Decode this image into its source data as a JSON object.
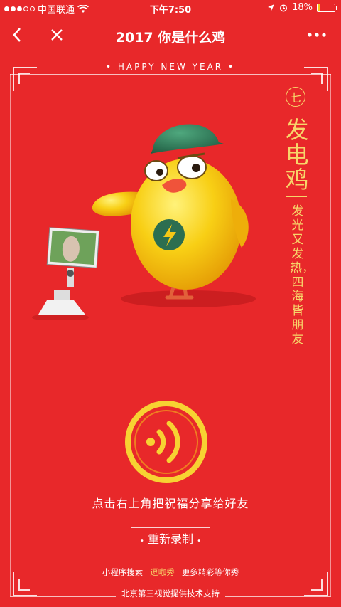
{
  "status_bar": {
    "carrier": "中国联通",
    "time": "下午7:50",
    "battery": "18%",
    "battery_level": 0.18
  },
  "nav": {
    "title": "2017 你是什么鸡",
    "back_icon": "chevron-left-icon",
    "close_icon": "close-icon",
    "more_icon": "more-icon"
  },
  "banner": "HAPPY NEW YEAR",
  "card": {
    "seal_glyph": "七",
    "name": "发电鸡",
    "blessing": "发光又发热，四海皆朋友"
  },
  "controls": {
    "share_hint": "点击右上角把祝福分享给好友",
    "rerecord_label": "重新录制"
  },
  "footer": {
    "mini_search": "小程序搜索",
    "mini_name": "逗咖秀",
    "mini_more": "更多精彩等你秀",
    "credit": "北京第三视觉提供技术支持"
  },
  "colors": {
    "background": "#e8282a",
    "gold": "#f7d56a",
    "chick_yellow": "#f7c815",
    "helmet_green": "#2f7d5a"
  }
}
